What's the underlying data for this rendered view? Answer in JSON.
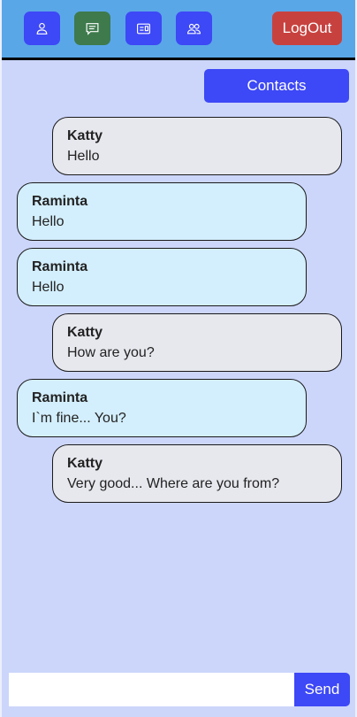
{
  "header": {
    "nav": [
      {
        "icon": "user-icon"
      },
      {
        "icon": "chat-icon",
        "active": true
      },
      {
        "icon": "id-card-icon"
      },
      {
        "icon": "users-icon"
      }
    ],
    "logout_label": "LogOut"
  },
  "contacts_label": "Contacts",
  "messages": [
    {
      "sender": "Katty",
      "text": "Hello",
      "side": "mine"
    },
    {
      "sender": "Raminta",
      "text": "Hello",
      "side": "theirs"
    },
    {
      "sender": "Raminta",
      "text": "Hello",
      "side": "theirs"
    },
    {
      "sender": "Katty",
      "text": "How are you?",
      "side": "mine"
    },
    {
      "sender": "Raminta",
      "text": "I`m fine... You?",
      "side": "theirs"
    },
    {
      "sender": "Katty",
      "text": "Very good... Where are you from?",
      "side": "mine"
    }
  ],
  "composer": {
    "value": "",
    "placeholder": "",
    "send_label": "Send"
  },
  "colors": {
    "background": "#ccd6fb",
    "header": "#5aa7e8",
    "primary": "#3d48f6",
    "active_nav": "#3e7a4c",
    "logout": "#c7423f",
    "mine_bubble": "#e7e8ee",
    "theirs_bubble": "#d3eefc"
  }
}
